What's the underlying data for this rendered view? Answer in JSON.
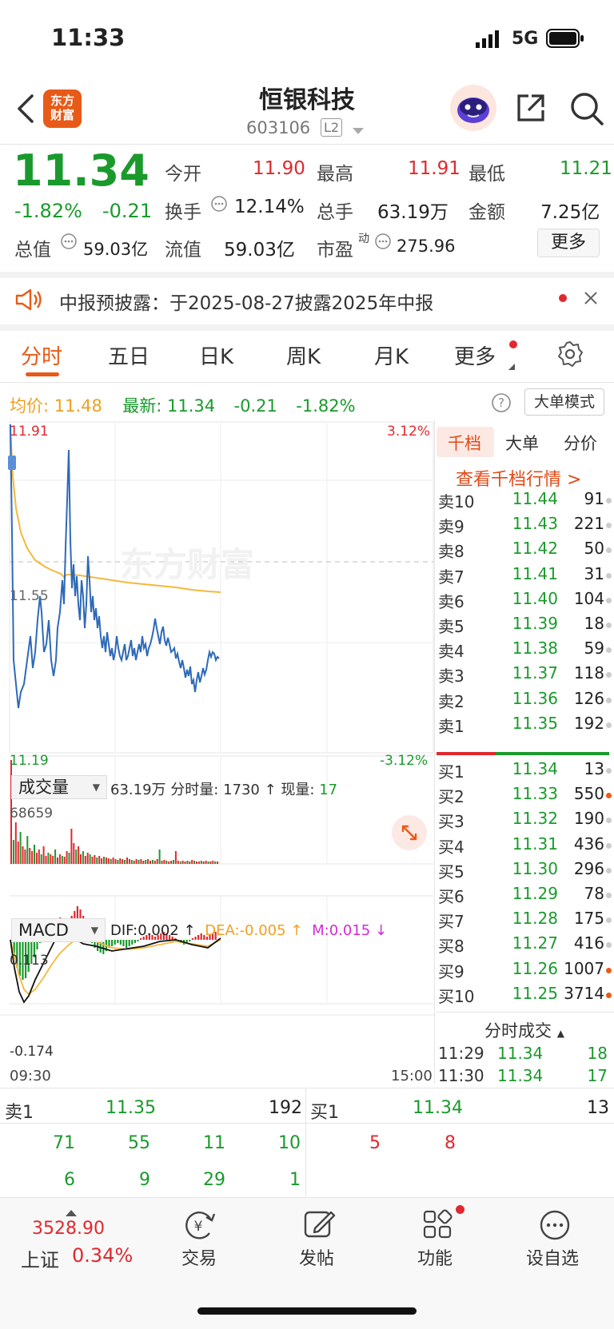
{
  "status": {
    "time": "11:33",
    "network": "5G"
  },
  "header": {
    "name": "恒银科技",
    "code": "603106",
    "level_badge": "L2",
    "brand_logo": [
      "东方",
      "财富"
    ]
  },
  "quote": {
    "price": "11.34",
    "change_pct": "-1.82%",
    "change": "-0.21",
    "open_label": "今开",
    "open": "11.90",
    "high_label": "最高",
    "high": "11.91",
    "low_label": "最低",
    "low": "11.21",
    "turnover_label": "换手",
    "turnover": "12.14%",
    "volume_label": "总手",
    "volume": "63.19万",
    "amount_label": "金额",
    "amount": "7.25亿",
    "mktcap_label": "总值",
    "mktcap": "59.03亿",
    "float_label": "流值",
    "float": "59.03亿",
    "pe_label": "市盈",
    "pe_sup": "动",
    "pe": "275.96",
    "more_label": "更多"
  },
  "notice": {
    "text": "中报预披露：于2025-08-27披露2025年中报"
  },
  "tabs": [
    "分时",
    "五日",
    "日K",
    "周K",
    "月K",
    "更多"
  ],
  "info_line": {
    "avg_label": "均价:",
    "avg": "11.48",
    "latest_label": "最新:",
    "latest": "11.34",
    "change": "-0.21",
    "pct": "-1.82%",
    "big_order_mode": "大单模式"
  },
  "intraday": {
    "y_high": "11.91",
    "y_mid": "11.55",
    "y_low": "11.19",
    "pct_high": "3.12%",
    "pct_low": "-3.12%",
    "watermark": "东方财富",
    "time_start": "09:30",
    "time_end": "15:00"
  },
  "volume_panel": {
    "selector": "成交量",
    "total": "63.19万",
    "tick_label": "分时量:",
    "tick_value": "1730",
    "now_label": "现量:",
    "now_value": "17",
    "max": "68659"
  },
  "macd_panel": {
    "selector": "MACD",
    "dif": "DIF:0.002",
    "dea": "DEA:-0.005",
    "m": "M:0.015",
    "top": "0.113",
    "bottom": "-0.174"
  },
  "order_book": {
    "tabs": [
      "千档",
      "大单",
      "分价"
    ],
    "link": "查看千档行情 >",
    "asks": [
      {
        "label": "卖10",
        "price": "11.44",
        "vol": "91",
        "hot": false
      },
      {
        "label": "卖9",
        "price": "11.43",
        "vol": "221",
        "hot": false
      },
      {
        "label": "卖8",
        "price": "11.42",
        "vol": "50",
        "hot": false
      },
      {
        "label": "卖7",
        "price": "11.41",
        "vol": "31",
        "hot": false
      },
      {
        "label": "卖6",
        "price": "11.40",
        "vol": "104",
        "hot": false
      },
      {
        "label": "卖5",
        "price": "11.39",
        "vol": "18",
        "hot": false
      },
      {
        "label": "卖4",
        "price": "11.38",
        "vol": "59",
        "hot": false
      },
      {
        "label": "卖3",
        "price": "11.37",
        "vol": "118",
        "hot": false
      },
      {
        "label": "卖2",
        "price": "11.36",
        "vol": "126",
        "hot": false
      },
      {
        "label": "卖1",
        "price": "11.35",
        "vol": "192",
        "hot": false
      }
    ],
    "bids": [
      {
        "label": "买1",
        "price": "11.34",
        "vol": "13",
        "hot": false
      },
      {
        "label": "买2",
        "price": "11.33",
        "vol": "550",
        "hot": true
      },
      {
        "label": "买3",
        "price": "11.32",
        "vol": "190",
        "hot": false
      },
      {
        "label": "买4",
        "price": "11.31",
        "vol": "436",
        "hot": false
      },
      {
        "label": "买5",
        "price": "11.30",
        "vol": "296",
        "hot": false
      },
      {
        "label": "买6",
        "price": "11.29",
        "vol": "78",
        "hot": false
      },
      {
        "label": "买7",
        "price": "11.28",
        "vol": "175",
        "hot": false
      },
      {
        "label": "买8",
        "price": "11.27",
        "vol": "416",
        "hot": false
      },
      {
        "label": "买9",
        "price": "11.26",
        "vol": "1007",
        "hot": true
      },
      {
        "label": "买10",
        "price": "11.25",
        "vol": "3714",
        "hot": true
      }
    ],
    "ticks_title": "分时成交",
    "ticks": [
      {
        "time": "11:29",
        "price": "11.34",
        "vol": "18"
      },
      {
        "time": "11:30",
        "price": "11.34",
        "vol": "17"
      }
    ]
  },
  "quick_book": {
    "ask_label": "卖1",
    "ask_price": "11.35",
    "ask_vol": "192",
    "bid_label": "买1",
    "bid_price": "11.34",
    "bid_vol": "13",
    "ask_row1": [
      "71",
      "55",
      "11",
      "10"
    ],
    "ask_row2": [
      "6",
      "9",
      "29",
      "1"
    ],
    "bid_row1": [
      "5",
      "8"
    ]
  },
  "bottom_nav": {
    "index_value": "3528.90",
    "index_name": "上证",
    "index_pct": "0.34%",
    "items": [
      "交易",
      "发帖",
      "功能",
      "设自选"
    ]
  }
}
